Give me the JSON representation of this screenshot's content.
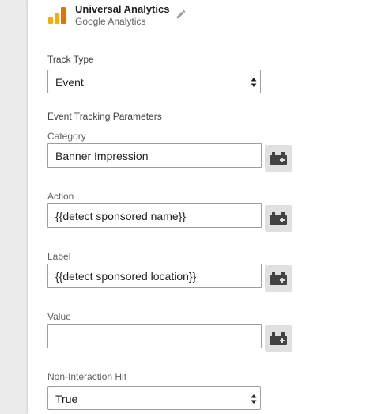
{
  "tag": {
    "name": "Universal Analytics",
    "type": "Google Analytics"
  },
  "track_type": {
    "label": "Track Type",
    "value": "Event"
  },
  "section_title": "Event Tracking Parameters",
  "fields": {
    "category": {
      "label": "Category",
      "value": "Banner Impression"
    },
    "action": {
      "label": "Action",
      "value": "{{detect sponsored name}}"
    },
    "label": {
      "label": "Label",
      "value": "{{detect sponsored location}}"
    },
    "value": {
      "label": "Value",
      "value": ""
    }
  },
  "non_interaction": {
    "label": "Non-Interaction Hit",
    "value": "True"
  },
  "icons": {
    "logo": "google-analytics-logo-icon",
    "edit": "pencil-icon",
    "variable": "variable-brick-icon",
    "select_arrows": "select-arrows-icon"
  },
  "colors": {
    "logo_orange": "#f9ab00",
    "logo_dark_orange": "#e37400",
    "icon_gray": "#9e9e9e",
    "var_button_bg": "#e0e0e0"
  }
}
